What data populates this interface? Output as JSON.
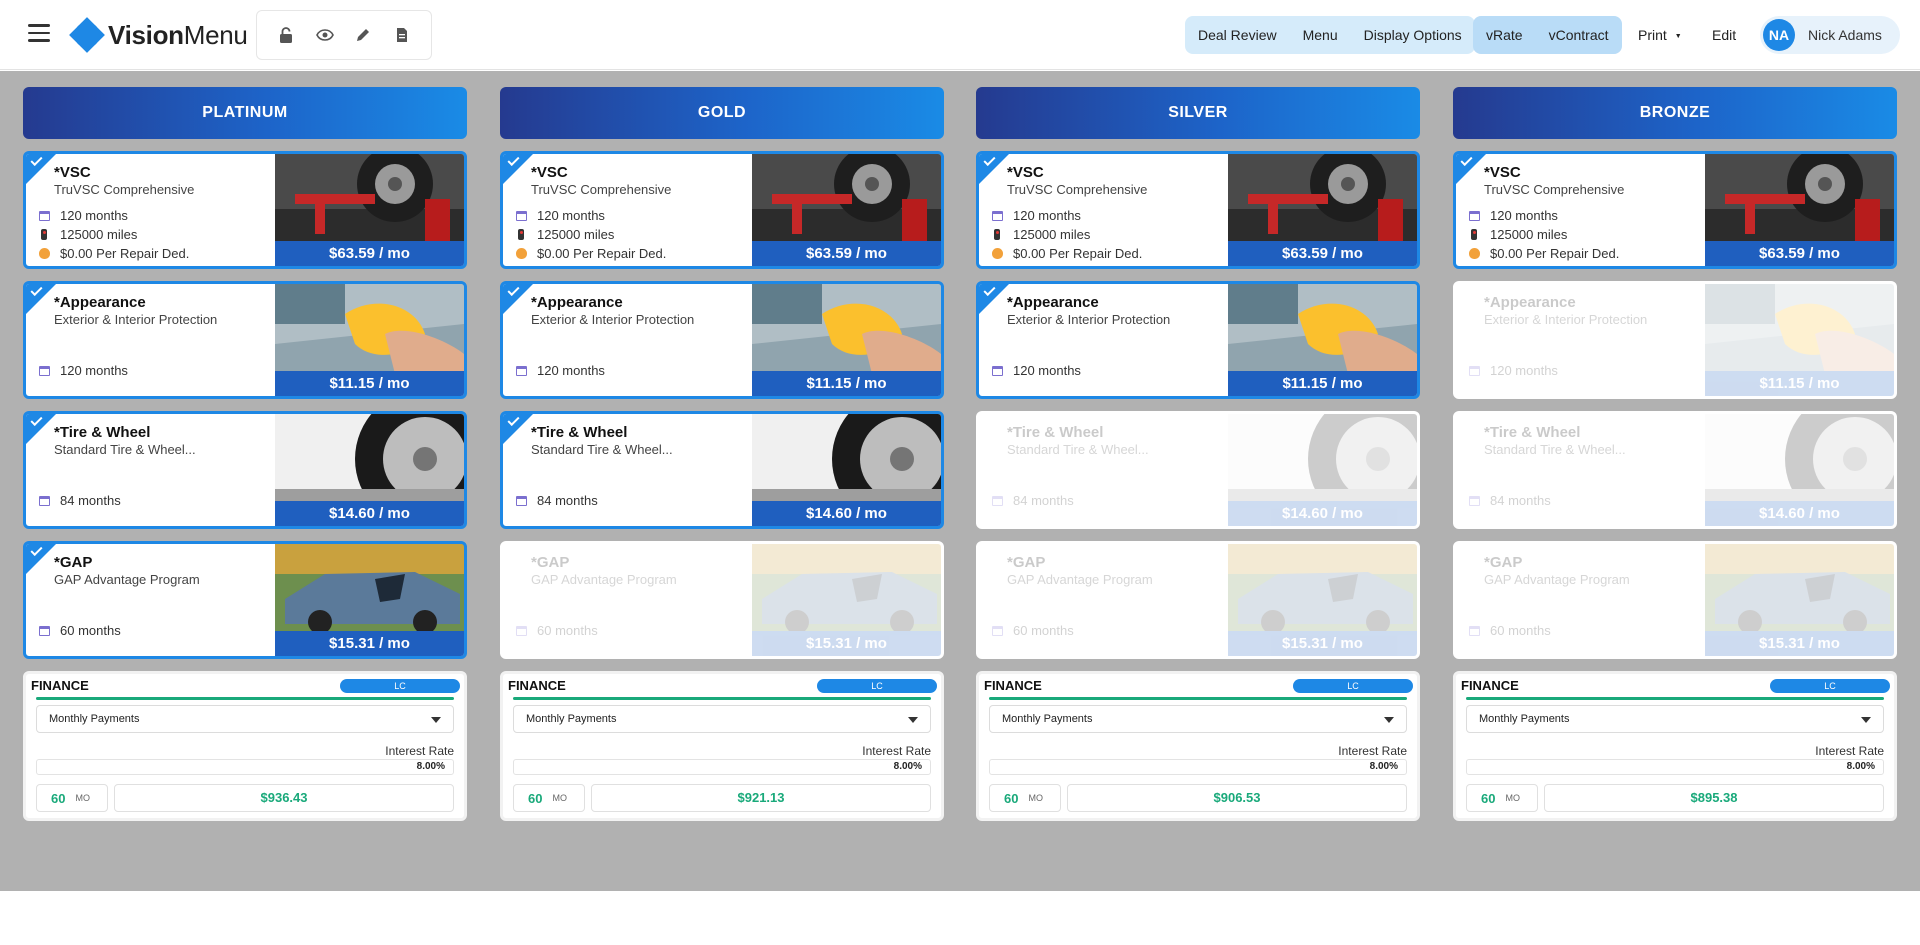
{
  "header": {
    "logo_bold": "Vision",
    "logo_light": "Menu",
    "nav_group1": [
      "Deal Review",
      "Menu",
      "Display Options"
    ],
    "nav_group2": [
      "vRate",
      "vContract"
    ],
    "print_label": "Print",
    "edit_label": "Edit",
    "user_initials": "NA",
    "user_name": "Nick Adams"
  },
  "products": {
    "vsc": {
      "name": "*VSC",
      "sub": "TruVSC Comprehensive",
      "term": "120 months",
      "miles": "125000 miles",
      "ded": "$0.00 Per Repair Ded.",
      "price": "$63.59 / mo"
    },
    "app": {
      "name": "*Appearance",
      "sub": "Exterior & Interior Protection",
      "term": "120 months",
      "price": "$11.15 / mo"
    },
    "tire": {
      "name": "*Tire & Wheel",
      "sub": "Standard Tire & Wheel...",
      "term": "84 months",
      "price": "$14.60 / mo"
    },
    "gap": {
      "name": "*GAP",
      "sub": "GAP Advantage Program",
      "term": "60 months",
      "price": "$15.31 / mo"
    }
  },
  "columns": [
    {
      "title": "PLATINUM",
      "selected": {
        "vsc": true,
        "app": true,
        "tire": true,
        "gap": true
      },
      "finance": {
        "title": "FINANCE",
        "badge": "LC",
        "mode": "Monthly Payments",
        "rate_label": "Interest Rate",
        "rate": "8.00%",
        "term": "60",
        "term_unit": "MO",
        "payment": "$936.43"
      }
    },
    {
      "title": "GOLD",
      "selected": {
        "vsc": true,
        "app": true,
        "tire": true,
        "gap": false
      },
      "finance": {
        "title": "FINANCE",
        "badge": "LC",
        "mode": "Monthly Payments",
        "rate_label": "Interest Rate",
        "rate": "8.00%",
        "term": "60",
        "term_unit": "MO",
        "payment": "$921.13"
      }
    },
    {
      "title": "SILVER",
      "selected": {
        "vsc": true,
        "app": true,
        "tire": false,
        "gap": false
      },
      "finance": {
        "title": "FINANCE",
        "badge": "LC",
        "mode": "Monthly Payments",
        "rate_label": "Interest Rate",
        "rate": "8.00%",
        "term": "60",
        "term_unit": "MO",
        "payment": "$906.53"
      }
    },
    {
      "title": "BRONZE",
      "selected": {
        "vsc": true,
        "app": false,
        "tire": false,
        "gap": false
      },
      "finance": {
        "title": "FINANCE",
        "badge": "LC",
        "mode": "Monthly Payments",
        "rate_label": "Interest Rate",
        "rate": "8.00%",
        "term": "60",
        "term_unit": "MO",
        "payment": "$895.38"
      }
    }
  ],
  "colors": {
    "accent": "#1e88e5",
    "price_bar": "#1f5fbf",
    "finance_green": "#19a97a",
    "background": "#b1b1b1"
  }
}
